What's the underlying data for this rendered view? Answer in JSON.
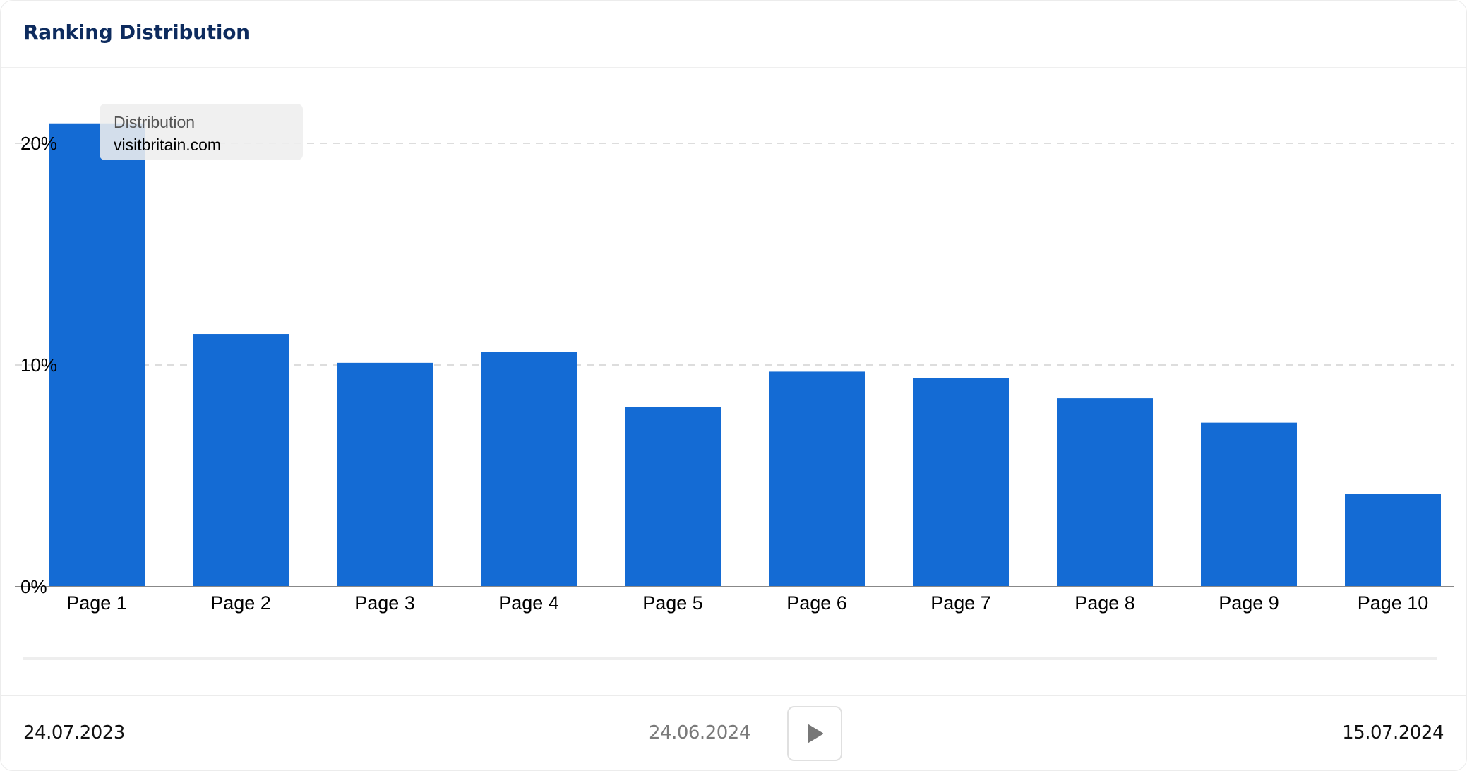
{
  "header": {
    "title": "Ranking Distribution"
  },
  "tooltip": {
    "label": "Distribution",
    "value": "visitbritain.com"
  },
  "timeline": {
    "start_date": "24.07.2023",
    "current_date": "24.06.2024",
    "end_date": "15.07.2024",
    "play_icon": "play-icon"
  },
  "colors": {
    "bar": "#146bd4",
    "title": "#0d2b5e",
    "grid": "#dddddd",
    "axis": "#888888"
  },
  "chart_data": {
    "type": "bar",
    "title": "Ranking Distribution",
    "series": [
      {
        "name": "visitbritain.com",
        "values": [
          20.9,
          11.4,
          10.1,
          10.6,
          8.1,
          9.7,
          9.4,
          8.5,
          7.4,
          4.2
        ]
      }
    ],
    "categories": [
      "Page 1",
      "Page 2",
      "Page 3",
      "Page 4",
      "Page 5",
      "Page 6",
      "Page 7",
      "Page 8",
      "Page 9",
      "Page 10"
    ],
    "values": [
      20.9,
      11.4,
      10.1,
      10.6,
      8.1,
      9.7,
      9.4,
      8.5,
      7.4,
      4.2
    ],
    "yticks": [
      0,
      10,
      20
    ],
    "ytick_labels": [
      "0%",
      "10%",
      "20%"
    ],
    "ylim": [
      0,
      20.9
    ],
    "xlabel": "",
    "ylabel": "",
    "grid": true,
    "legend": "none",
    "unit": "%"
  }
}
